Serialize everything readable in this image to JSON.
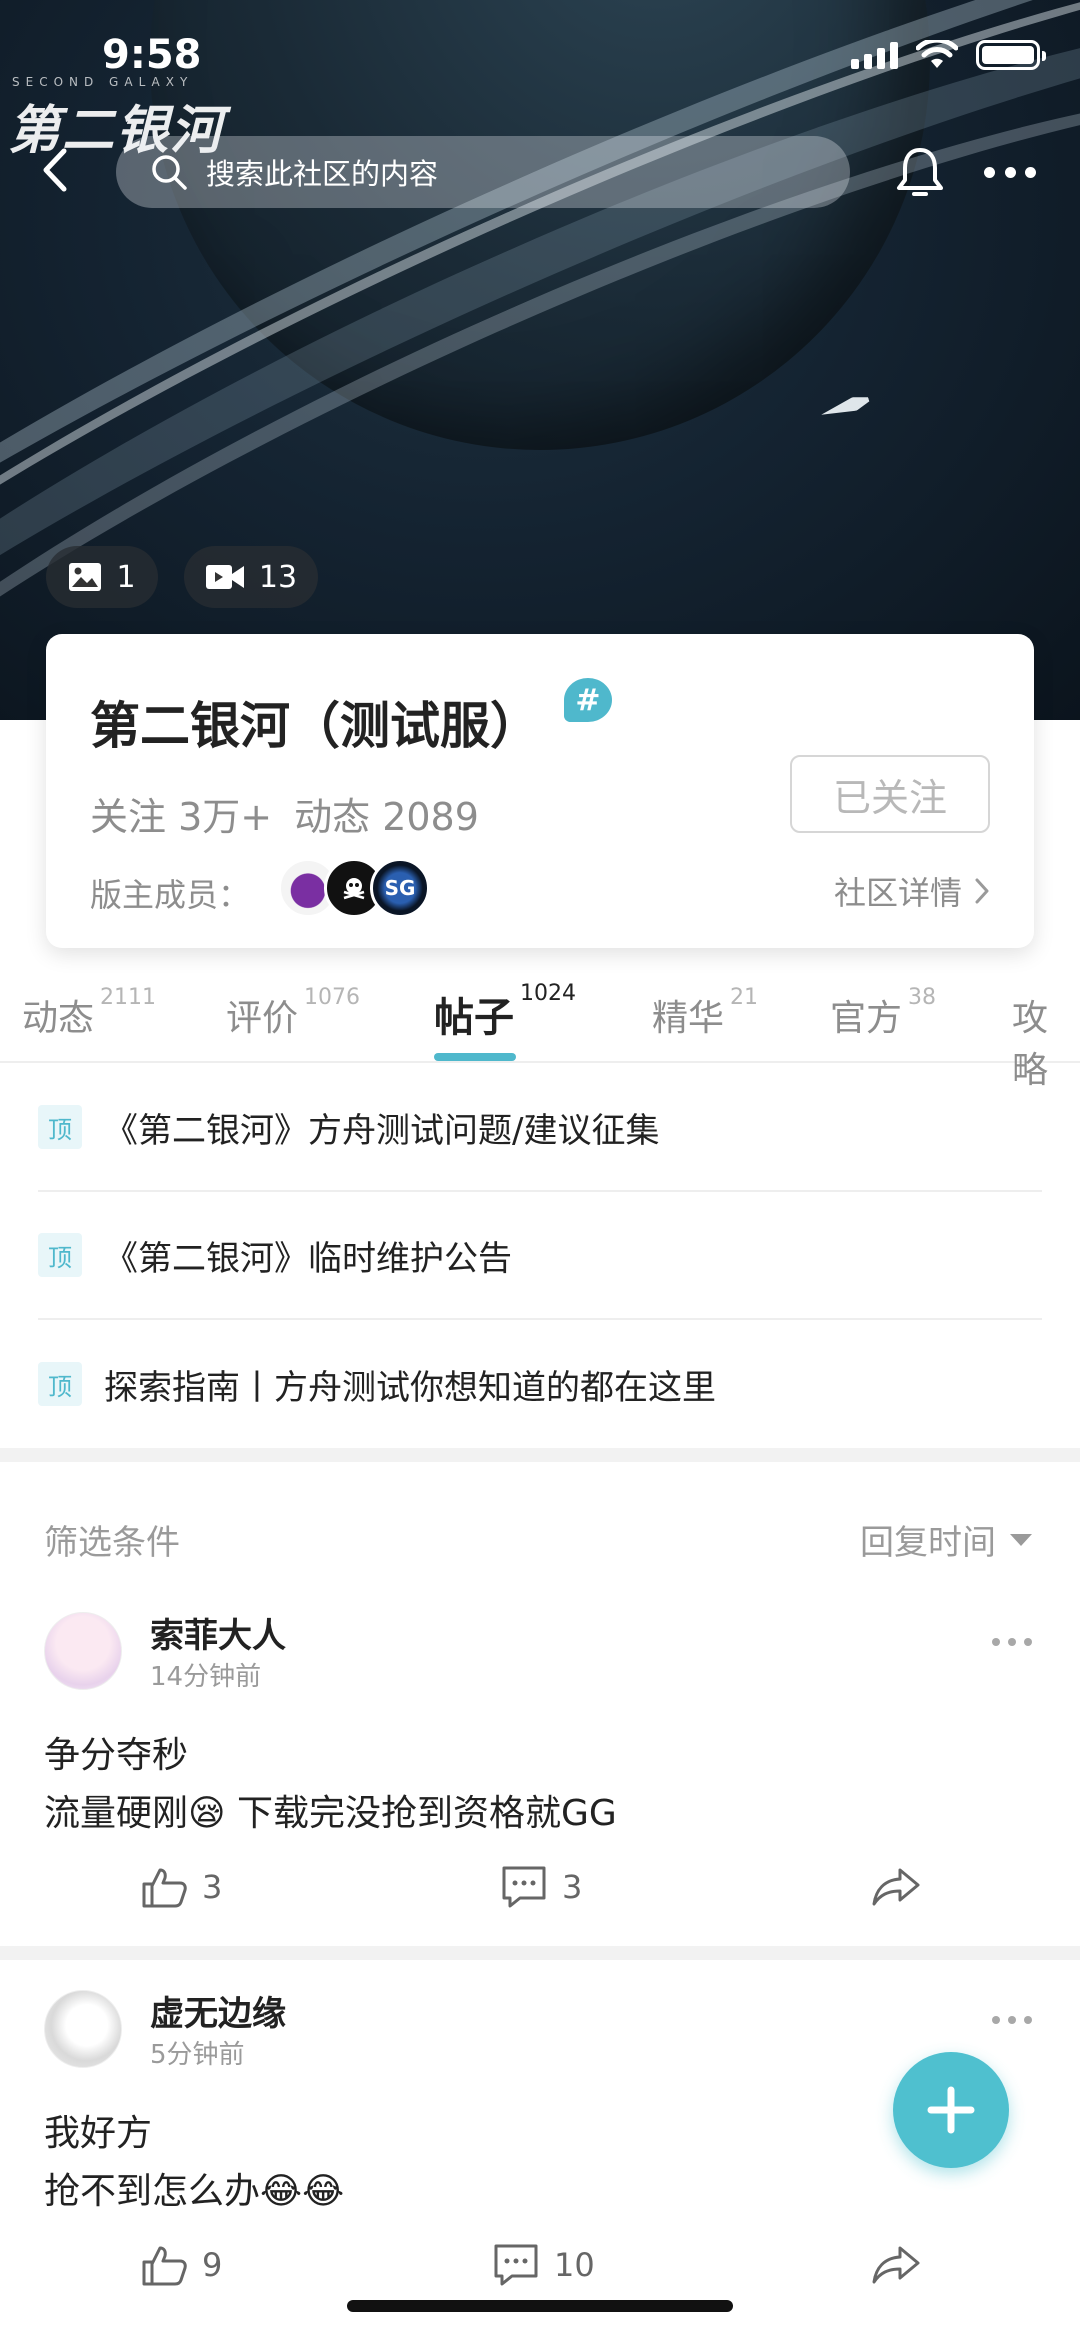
{
  "status_bar": {
    "time": "9:58"
  },
  "hero": {
    "logo_text": "第二银河",
    "logo_sub": "SECOND GALAXY",
    "search_placeholder": "搜索此社区的内容",
    "image_count": "1",
    "video_count": "13"
  },
  "community": {
    "title": "第二银河（测试服）",
    "badge": "#",
    "followers": "关注 3万+",
    "posts": "动态 2089",
    "follow_button": "已关注",
    "moderators_label": "版主成员：",
    "detail_link": "社区详情"
  },
  "tabs": [
    {
      "label": "动态",
      "count": "2111"
    },
    {
      "label": "评价",
      "count": "1076"
    },
    {
      "label": "帖子",
      "count": "1024"
    },
    {
      "label": "精华",
      "count": "21"
    },
    {
      "label": "官方",
      "count": "38"
    },
    {
      "label": "攻略",
      "count": ""
    }
  ],
  "active_tab": "帖子",
  "pinned": [
    {
      "badge": "顶",
      "title": "《第二银河》方舟测试问题/建议征集"
    },
    {
      "badge": "顶",
      "title": "《第二银河》临时维护公告"
    },
    {
      "badge": "顶",
      "title": "探索指南丨方舟测试你想知道的都在这里"
    }
  ],
  "filter": {
    "label": "筛选条件",
    "sort": "回复时间"
  },
  "posts": [
    {
      "user": "索菲大人",
      "time": "14分钟前",
      "line1": "争分夺秒",
      "line2": "流量硬刚😪 下载完没抢到资格就GG",
      "likes": "3",
      "comments": "3"
    },
    {
      "user": "虚无边缘",
      "time": "5分钟前",
      "line1": "我好方",
      "line2": "抢不到怎么办😂😂",
      "likes": "9",
      "comments": "10"
    }
  ],
  "colors": {
    "accent": "#4fb8cc",
    "fab": "#4fc0cf",
    "muted": "#8d8d8d"
  }
}
